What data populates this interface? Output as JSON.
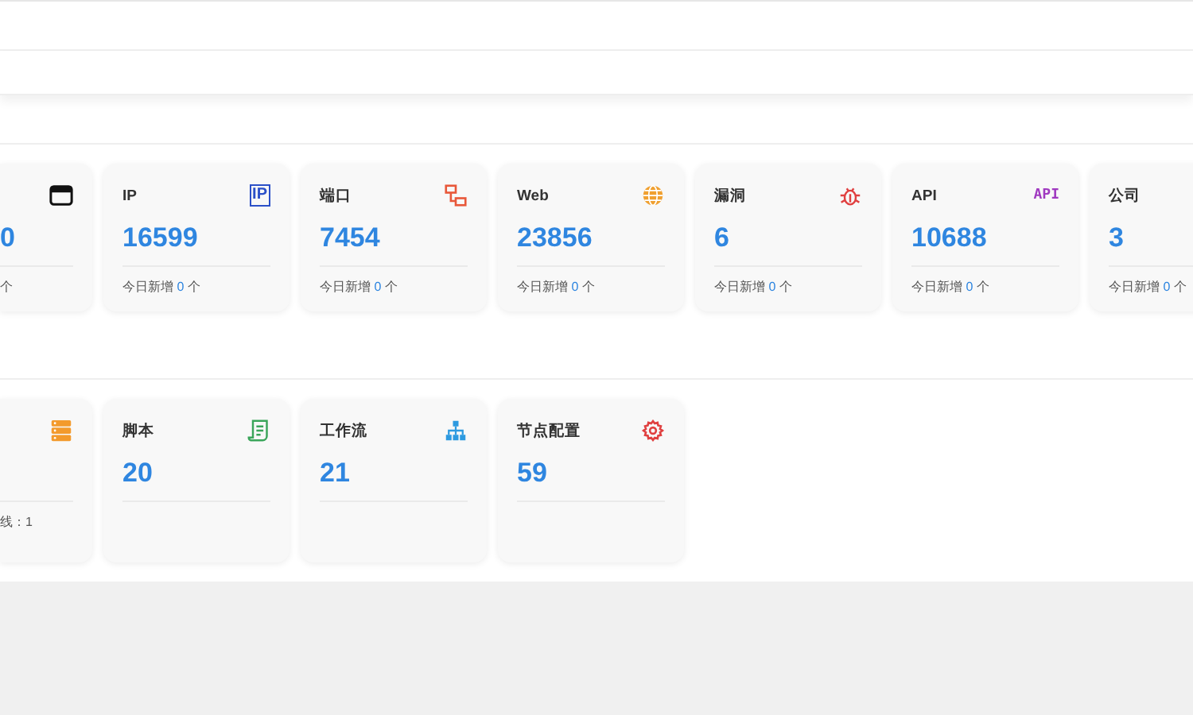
{
  "asset_cards": [
    {
      "value": "0",
      "footer_suffix": "个"
    },
    {
      "icon_text": "IP",
      "label": "IP",
      "value": "16599",
      "footer_prefix": "今日新增",
      "footer_count": "0",
      "footer_suffix": "个"
    },
    {
      "label": "端口",
      "value": "7454",
      "footer_prefix": "今日新增",
      "footer_count": "0",
      "footer_suffix": "个"
    },
    {
      "label": "Web",
      "value": "23856",
      "footer_prefix": "今日新增",
      "footer_count": "0",
      "footer_suffix": "个"
    },
    {
      "label": "漏洞",
      "value": "6",
      "footer_prefix": "今日新增",
      "footer_count": "0",
      "footer_suffix": "个"
    },
    {
      "icon_text": "API",
      "label": "API",
      "value": "10688",
      "footer_prefix": "今日新增",
      "footer_count": "0",
      "footer_suffix": "个"
    },
    {
      "label": "公司",
      "value": "3",
      "footer_prefix": "今日新增",
      "footer_count": "0",
      "footer_suffix": "个"
    }
  ],
  "system_cards": [
    {
      "footer_suffix": "线：1"
    },
    {
      "label": "脚本",
      "value": "20"
    },
    {
      "label": "工作流",
      "value": "21"
    },
    {
      "label": "节点配置",
      "value": "59"
    }
  ]
}
